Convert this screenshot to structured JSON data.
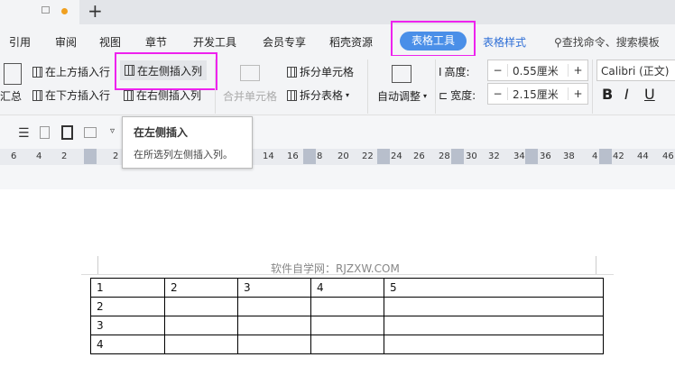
{
  "menu": [
    "引用",
    "审阅",
    "视图",
    "章节",
    "开发工具",
    "会员专享",
    "稻壳资源"
  ],
  "active_tab": "表格工具",
  "style_tab": "表格样式",
  "search": "查找命令、搜索模板",
  "ribbon": {
    "summary": "汇总",
    "insert_above": "在上方插入行",
    "insert_below": "在下方插入行",
    "insert_left": "在左侧插入列",
    "insert_right": "在右侧插入列",
    "merge": "合并单元格",
    "split_cell": "拆分单元格",
    "split_table": "拆分表格",
    "autofit": "自动调整",
    "height_label": "高度:",
    "height_value": "0.55厘米",
    "width_label": "宽度:",
    "width_value": "2.15厘米",
    "font": "Calibri (正文)",
    "bold": "B",
    "italic": "I",
    "underline": "U",
    "minus": "−",
    "plus": "+"
  },
  "tooltip": {
    "title": "在左侧插入",
    "desc": "在所选列左侧插入列。"
  },
  "ruler": [
    "6",
    "4",
    "2",
    "2",
    "14",
    "16",
    "8",
    "20",
    "22",
    "24",
    "26",
    "28",
    "30",
    "32",
    "34",
    "36",
    "38",
    "4",
    "42",
    "44",
    "46"
  ],
  "doc": {
    "header": "软件自学网：RJZXW.COM",
    "table": [
      [
        "1",
        "2",
        "3",
        "4",
        "5"
      ],
      [
        "2",
        "",
        "",
        "",
        ""
      ],
      [
        "3",
        "",
        "",
        "",
        ""
      ],
      [
        "4",
        "",
        "",
        "",
        ""
      ]
    ]
  }
}
